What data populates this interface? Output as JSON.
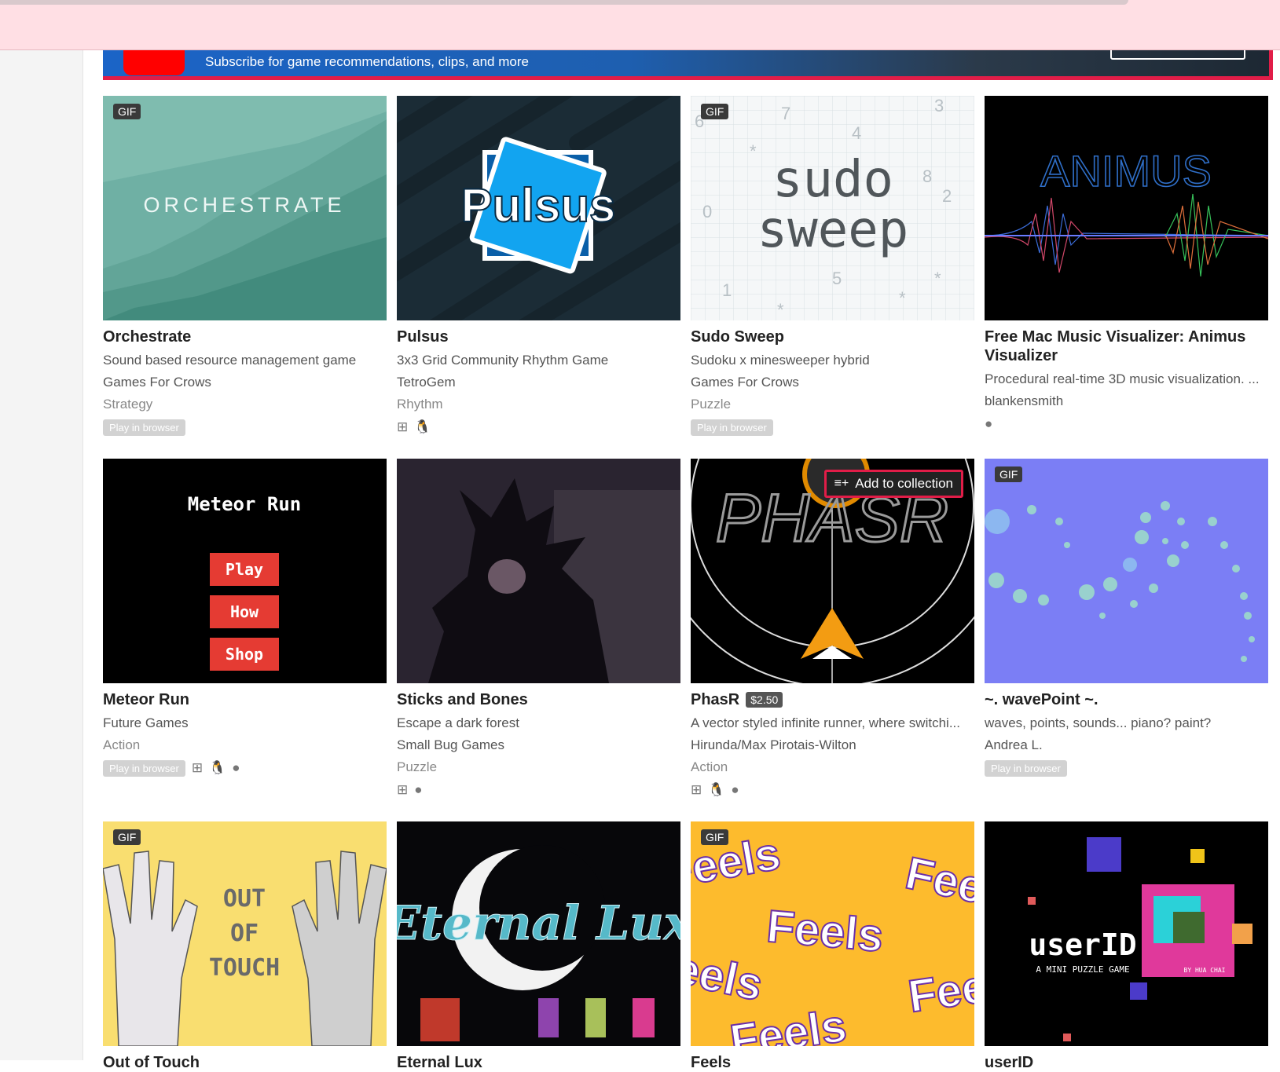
{
  "banner": {
    "text": "Subscribe for game recommendations, clips, and more"
  },
  "labels": {
    "gif": "GIF",
    "play_in_browser": "Play in browser",
    "add_to_collection": "Add to collection"
  },
  "games": [
    {
      "title": "Orchestrate",
      "description": "Sound based resource management game",
      "author": "Games For Crows",
      "genre": "Strategy",
      "gif": true,
      "browser": true,
      "platforms": [],
      "thumb_text": "ORCHESTRATE"
    },
    {
      "title": "Pulsus",
      "description": "3x3 Grid Community Rhythm Game",
      "author": "TetroGem",
      "genre": "Rhythm",
      "gif": false,
      "browser": false,
      "platforms": [
        "windows-icon",
        "linux-icon"
      ],
      "thumb_text": "Pulsus"
    },
    {
      "title": "Sudo Sweep",
      "description": "Sudoku x minesweeper hybrid",
      "author": "Games For Crows",
      "genre": "Puzzle",
      "gif": true,
      "browser": true,
      "platforms": [],
      "thumb_text": [
        "sudo",
        "sweep"
      ]
    },
    {
      "title": "Free Mac Music Visualizer: Animus Visualizer",
      "description": "Procedural real-time 3D music visualization. ...",
      "author": "blankensmith",
      "genre": "",
      "gif": false,
      "browser": false,
      "platforms": [
        "apple-icon"
      ],
      "thumb_text": "ANIMUS"
    },
    {
      "title": "Meteor Run",
      "description": "",
      "author": "Future Games",
      "genre": "Action",
      "gif": false,
      "browser": true,
      "platforms": [
        "windows-icon",
        "linux-icon",
        "apple-icon"
      ],
      "thumb_text": [
        "Meteor Run",
        "Play",
        "How",
        "Shop"
      ]
    },
    {
      "title": "Sticks and Bones",
      "description": "Escape a dark forest",
      "author": "Small Bug Games",
      "genre": "Puzzle",
      "gif": false,
      "browser": false,
      "platforms": [
        "windows-icon",
        "apple-icon"
      ]
    },
    {
      "title": "PhasR",
      "price": "$2.50",
      "description": "A vector styled infinite runner, where switchi...",
      "author": "Hirunda/Max Pirotais-Wilton",
      "genre": "Action",
      "gif": false,
      "browser": false,
      "platforms": [
        "windows-icon",
        "linux-icon",
        "apple-icon"
      ],
      "hovered": true,
      "thumb_text": "PHASR"
    },
    {
      "title": "~. wavePoint ~.",
      "description": "waves, points, sounds... piano? paint?",
      "author": "Andrea L.",
      "genre": "",
      "gif": true,
      "browser": true,
      "platforms": []
    },
    {
      "title": "Out of Touch",
      "gif": true,
      "thumb_text": [
        "OUT",
        "OF",
        "TOUCH"
      ]
    },
    {
      "title": "Eternal Lux",
      "gif": false,
      "thumb_text": "Eternal Lux"
    },
    {
      "title": "Feels",
      "gif": true,
      "thumb_text": "Feels"
    },
    {
      "title": "userID",
      "gif": false,
      "thumb_text": [
        "userID",
        "A MINI PUZZLE GAME",
        "BY HUA CHAI"
      ]
    }
  ],
  "colors": {
    "accent": "#e11d48",
    "topbar": "#ffdfe4"
  }
}
